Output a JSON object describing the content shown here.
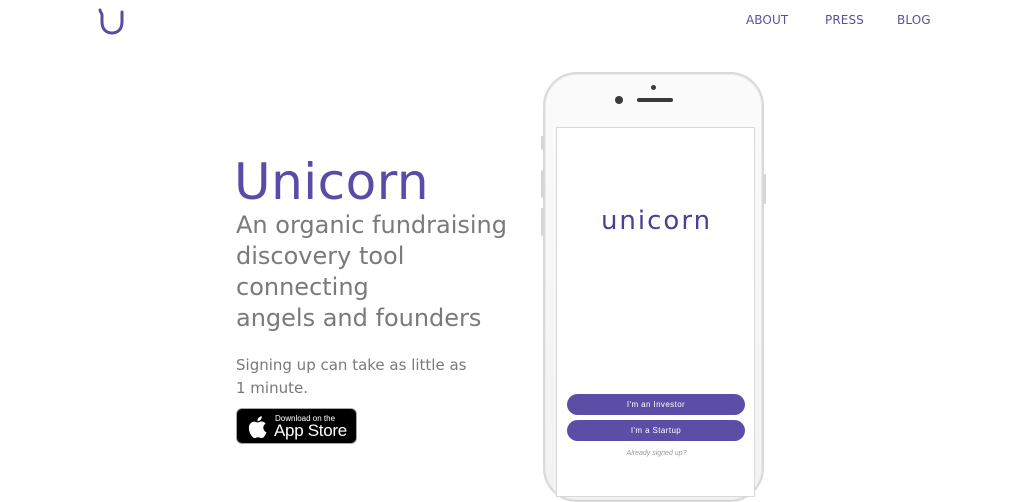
{
  "brand": {
    "logo_icon": "u-logo-icon",
    "accent_color": "#5b4aa6"
  },
  "nav": {
    "items": [
      {
        "label": "ABOUT"
      },
      {
        "label": "PRESS"
      },
      {
        "label": "BLOG"
      }
    ]
  },
  "hero": {
    "title": "Unicorn",
    "tagline_lines": [
      "An organic fundraising",
      "discovery tool",
      "connecting",
      "angels and founders"
    ],
    "signup_note": "Signing up can take as little as 1 minute."
  },
  "app_store": {
    "small_text": "Download on the",
    "big_text": "App Store",
    "icon": "apple-icon"
  },
  "phone": {
    "screen_logo": "unicorn",
    "investor_button": "I'm an Investor",
    "startup_button": "I'm a Startup",
    "signed_up_link": "Already signed up?"
  }
}
